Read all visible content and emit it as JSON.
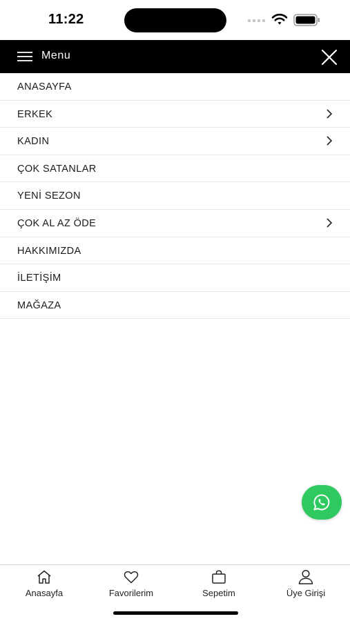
{
  "status_bar": {
    "time": "11:22"
  },
  "header": {
    "menu_label": "Menu"
  },
  "menu": {
    "items": [
      {
        "label": "ANASAYFA",
        "has_submenu": false
      },
      {
        "label": "ERKEK",
        "has_submenu": true
      },
      {
        "label": "KADIN",
        "has_submenu": true
      },
      {
        "label": "ÇOK SATANLAR",
        "has_submenu": false
      },
      {
        "label": "YENİ SEZON",
        "has_submenu": false
      },
      {
        "label": "ÇOK AL AZ ÖDE",
        "has_submenu": true
      },
      {
        "label": "HAKKIMIZDA",
        "has_submenu": false
      },
      {
        "label": "İLETİŞİM",
        "has_submenu": false
      },
      {
        "label": "MAĞAZA",
        "has_submenu": false
      }
    ]
  },
  "fab": {
    "icon": "whatsapp-icon",
    "color": "#2fc95f"
  },
  "bottom_nav": {
    "items": [
      {
        "label": "Anasayfa",
        "icon": "home-icon"
      },
      {
        "label": "Favorilerim",
        "icon": "heart-icon"
      },
      {
        "label": "Sepetim",
        "icon": "bag-icon"
      },
      {
        "label": "Üye Girişi",
        "icon": "user-icon"
      }
    ]
  }
}
